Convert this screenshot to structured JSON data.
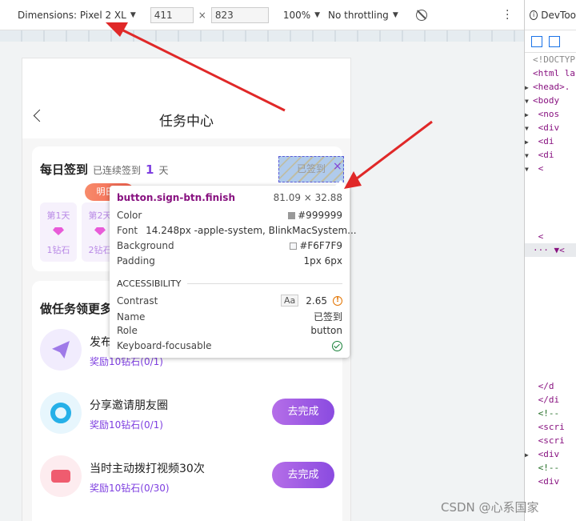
{
  "toolbar": {
    "device_label": "Dimensions: Pixel 2 XL",
    "width_value": "411",
    "times": "×",
    "height_value": "823",
    "zoom": "100%",
    "throttling": "No throttling"
  },
  "devtools": {
    "tab_label": "DevToo",
    "info_glyph": "i",
    "lines": [
      {
        "text": "<!DOCTYP",
        "cls": "gr",
        "mk": "",
        "sel": false
      },
      {
        "text": "<html la",
        "cls": "",
        "mk": "",
        "sel": false
      },
      {
        "text": "<head>.",
        "cls": "",
        "mk": "▶",
        "sel": false
      },
      {
        "text": "<body",
        "cls": "",
        "mk": "▼",
        "sel": false
      },
      {
        "text": " <nos",
        "cls": "",
        "mk": "▶",
        "sel": false
      },
      {
        "text": " <div",
        "cls": "",
        "mk": "▼",
        "sel": false
      },
      {
        "text": "  <di",
        "cls": "",
        "mk": "▶",
        "sel": false
      },
      {
        "text": "  <di",
        "cls": "",
        "mk": "▼",
        "sel": false
      },
      {
        "text": "   <",
        "cls": "",
        "mk": "▼",
        "sel": false
      },
      {
        "text": "",
        "cls": "",
        "mk": "",
        "sel": false
      },
      {
        "text": "",
        "cls": "",
        "mk": "",
        "sel": false
      },
      {
        "text": "",
        "cls": "",
        "mk": "",
        "sel": false
      },
      {
        "text": "",
        "cls": "",
        "mk": "",
        "sel": false
      },
      {
        "text": "    <",
        "cls": "",
        "mk": "",
        "sel": false
      },
      {
        "text": "··· ▼<",
        "cls": "",
        "mk": "",
        "sel": true
      },
      {
        "text": "",
        "cls": "",
        "mk": "",
        "sel": false
      },
      {
        "text": "",
        "cls": "",
        "mk": "",
        "sel": false
      },
      {
        "text": "",
        "cls": "",
        "mk": "",
        "sel": false
      },
      {
        "text": "",
        "cls": "",
        "mk": "",
        "sel": false
      },
      {
        "text": "",
        "cls": "",
        "mk": "",
        "sel": false
      },
      {
        "text": "",
        "cls": "",
        "mk": "",
        "sel": false
      },
      {
        "text": "",
        "cls": "",
        "mk": "",
        "sel": false
      },
      {
        "text": "",
        "cls": "",
        "mk": "",
        "sel": false
      },
      {
        "text": "",
        "cls": "",
        "mk": "",
        "sel": false
      },
      {
        "text": "   </d",
        "cls": "",
        "mk": "",
        "sel": false
      },
      {
        "text": "  </di",
        "cls": "",
        "mk": "",
        "sel": false
      },
      {
        "text": " <!--",
        "cls": "cm",
        "mk": "",
        "sel": false
      },
      {
        "text": " <scri",
        "cls": "",
        "mk": "",
        "sel": false
      },
      {
        "text": " <scri",
        "cls": "",
        "mk": "",
        "sel": false
      },
      {
        "text": " <div",
        "cls": "",
        "mk": "▶",
        "sel": false
      },
      {
        "text": " <!--",
        "cls": "cm",
        "mk": "",
        "sel": false
      },
      {
        "text": " <div",
        "cls": "",
        "mk": "",
        "sel": false
      }
    ]
  },
  "page": {
    "title": "任务中心",
    "sign": {
      "title": "每日签到",
      "sub": "已连续签到",
      "days": "1",
      "unit": "天",
      "button_label": "已签到",
      "badge": "明日可",
      "days_list": [
        {
          "label": "第1天",
          "reward": "1钻石"
        },
        {
          "label": "第2天",
          "reward": "2钻石"
        }
      ]
    },
    "tasks": {
      "title": "做任务领更多",
      "items": [
        {
          "name": "发布",
          "reward": "奖励10钻石(0/1)",
          "button": ""
        },
        {
          "name": "分享邀请朋友圈",
          "reward": "奖励10钻石(0/1)",
          "button": "去完成"
        },
        {
          "name": "当时主动拨打视频30次",
          "reward": "奖励10钻石(0/30)",
          "button": "去完成"
        }
      ]
    }
  },
  "tooltip": {
    "selector": "button.sign-btn.finish",
    "dimensions": "81.09 × 32.88",
    "color_label": "Color",
    "color_value": "#999999",
    "font_label": "Font",
    "font_value": "14.248px -apple-system, BlinkMacSystem...",
    "background_label": "Background",
    "background_value": "#F6F7F9",
    "padding_label": "Padding",
    "padding_value": "1px 6px",
    "section": "ACCESSIBILITY",
    "contrast_label": "Contrast",
    "contrast_aa": "Aa",
    "contrast_value": "2.65",
    "warn_glyph": "!",
    "name_label": "Name",
    "name_value": "已签到",
    "role_label": "Role",
    "role_value": "button",
    "keyboard_label": "Keyboard-focusable"
  },
  "colors": {
    "accent": "#7e3fe0",
    "arrow": "#e02828",
    "text_swatch": "#999999",
    "bg_swatch": "#F6F7F9"
  },
  "watermark": "CSDN @心系国家"
}
